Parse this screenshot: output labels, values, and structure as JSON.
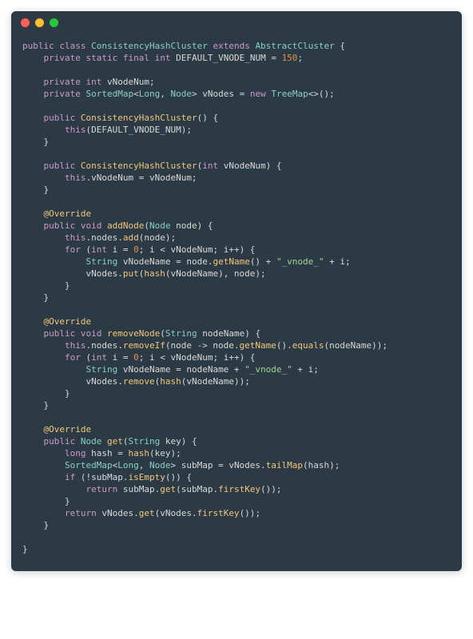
{
  "window": {
    "traffic_lights": [
      "close",
      "minimize",
      "zoom"
    ]
  },
  "code": {
    "tokens": [
      [
        [
          "kw",
          "public"
        ],
        [
          "punc",
          " "
        ],
        [
          "kw",
          "class"
        ],
        [
          "punc",
          " "
        ],
        [
          "type",
          "ConsistencyHashCluster"
        ],
        [
          "punc",
          " "
        ],
        [
          "kw",
          "extends"
        ],
        [
          "punc",
          " "
        ],
        [
          "type",
          "AbstractCluster"
        ],
        [
          "punc",
          " {"
        ]
      ],
      [
        [
          "punc",
          "    "
        ],
        [
          "kw",
          "private"
        ],
        [
          "punc",
          " "
        ],
        [
          "kw",
          "static"
        ],
        [
          "punc",
          " "
        ],
        [
          "kw",
          "final"
        ],
        [
          "punc",
          " "
        ],
        [
          "kw",
          "int"
        ],
        [
          "punc",
          " DEFAULT_VNODE_NUM = "
        ],
        [
          "num",
          "150"
        ],
        [
          "punc",
          ";"
        ]
      ],
      [
        [
          "punc",
          ""
        ]
      ],
      [
        [
          "punc",
          "    "
        ],
        [
          "kw",
          "private"
        ],
        [
          "punc",
          " "
        ],
        [
          "kw",
          "int"
        ],
        [
          "punc",
          " vNodeNum;"
        ]
      ],
      [
        [
          "punc",
          "    "
        ],
        [
          "kw",
          "private"
        ],
        [
          "punc",
          " "
        ],
        [
          "type",
          "SortedMap"
        ],
        [
          "punc",
          "<"
        ],
        [
          "type",
          "Long"
        ],
        [
          "punc",
          ", "
        ],
        [
          "type",
          "Node"
        ],
        [
          "punc",
          "> vNodes = "
        ],
        [
          "kw",
          "new"
        ],
        [
          "punc",
          " "
        ],
        [
          "type",
          "TreeMap"
        ],
        [
          "punc",
          "<>();"
        ]
      ],
      [
        [
          "punc",
          ""
        ]
      ],
      [
        [
          "punc",
          "    "
        ],
        [
          "kw",
          "public"
        ],
        [
          "punc",
          " "
        ],
        [
          "fn",
          "ConsistencyHashCluster"
        ],
        [
          "punc",
          "() {"
        ]
      ],
      [
        [
          "punc",
          "        "
        ],
        [
          "kw",
          "this"
        ],
        [
          "punc",
          "(DEFAULT_VNODE_NUM);"
        ]
      ],
      [
        [
          "punc",
          "    }"
        ]
      ],
      [
        [
          "punc",
          ""
        ]
      ],
      [
        [
          "punc",
          "    "
        ],
        [
          "kw",
          "public"
        ],
        [
          "punc",
          " "
        ],
        [
          "fn",
          "ConsistencyHashCluster"
        ],
        [
          "punc",
          "("
        ],
        [
          "kw",
          "int"
        ],
        [
          "punc",
          " vNodeNum) {"
        ]
      ],
      [
        [
          "punc",
          "        "
        ],
        [
          "kw",
          "this"
        ],
        [
          "punc",
          ".vNodeNum = vNodeNum;"
        ]
      ],
      [
        [
          "punc",
          "    }"
        ]
      ],
      [
        [
          "punc",
          ""
        ]
      ],
      [
        [
          "punc",
          "    "
        ],
        [
          "fn",
          "@Override"
        ]
      ],
      [
        [
          "punc",
          "    "
        ],
        [
          "kw",
          "public"
        ],
        [
          "punc",
          " "
        ],
        [
          "kw",
          "void"
        ],
        [
          "punc",
          " "
        ],
        [
          "fn",
          "addNode"
        ],
        [
          "punc",
          "("
        ],
        [
          "type",
          "Node"
        ],
        [
          "punc",
          " node) {"
        ]
      ],
      [
        [
          "punc",
          "        "
        ],
        [
          "kw",
          "this"
        ],
        [
          "punc",
          ".nodes."
        ],
        [
          "fn",
          "add"
        ],
        [
          "punc",
          "(node);"
        ]
      ],
      [
        [
          "punc",
          "        "
        ],
        [
          "kw",
          "for"
        ],
        [
          "punc",
          " ("
        ],
        [
          "kw",
          "int"
        ],
        [
          "punc",
          " i = "
        ],
        [
          "num",
          "0"
        ],
        [
          "punc",
          "; i < vNodeNum; i++) {"
        ]
      ],
      [
        [
          "punc",
          "            "
        ],
        [
          "type",
          "String"
        ],
        [
          "punc",
          " vNodeName = node."
        ],
        [
          "fn",
          "getName"
        ],
        [
          "punc",
          "() + "
        ],
        [
          "str",
          "\"_vnode_\""
        ],
        [
          "punc",
          " + i;"
        ]
      ],
      [
        [
          "punc",
          "            vNodes."
        ],
        [
          "fn",
          "put"
        ],
        [
          "punc",
          "("
        ],
        [
          "fn",
          "hash"
        ],
        [
          "punc",
          "(vNodeName), node);"
        ]
      ],
      [
        [
          "punc",
          "        }"
        ]
      ],
      [
        [
          "punc",
          "    }"
        ]
      ],
      [
        [
          "punc",
          ""
        ]
      ],
      [
        [
          "punc",
          "    "
        ],
        [
          "fn",
          "@Override"
        ]
      ],
      [
        [
          "punc",
          "    "
        ],
        [
          "kw",
          "public"
        ],
        [
          "punc",
          " "
        ],
        [
          "kw",
          "void"
        ],
        [
          "punc",
          " "
        ],
        [
          "fn",
          "removeNode"
        ],
        [
          "punc",
          "("
        ],
        [
          "type",
          "String"
        ],
        [
          "punc",
          " nodeName) {"
        ]
      ],
      [
        [
          "punc",
          "        "
        ],
        [
          "kw",
          "this"
        ],
        [
          "punc",
          ".nodes."
        ],
        [
          "fn",
          "removeIf"
        ],
        [
          "punc",
          "(node -> node."
        ],
        [
          "fn",
          "getName"
        ],
        [
          "punc",
          "()."
        ],
        [
          "fn",
          "equals"
        ],
        [
          "punc",
          "(nodeName));"
        ]
      ],
      [
        [
          "punc",
          "        "
        ],
        [
          "kw",
          "for"
        ],
        [
          "punc",
          " ("
        ],
        [
          "kw",
          "int"
        ],
        [
          "punc",
          " i = "
        ],
        [
          "num",
          "0"
        ],
        [
          "punc",
          "; i < vNodeNum; i++) {"
        ]
      ],
      [
        [
          "punc",
          "            "
        ],
        [
          "type",
          "String"
        ],
        [
          "punc",
          " vNodeName = nodeName + "
        ],
        [
          "str",
          "\"_vnode_\""
        ],
        [
          "punc",
          " + i;"
        ]
      ],
      [
        [
          "punc",
          "            vNodes."
        ],
        [
          "fn",
          "remove"
        ],
        [
          "punc",
          "("
        ],
        [
          "fn",
          "hash"
        ],
        [
          "punc",
          "(vNodeName));"
        ]
      ],
      [
        [
          "punc",
          "        }"
        ]
      ],
      [
        [
          "punc",
          "    }"
        ]
      ],
      [
        [
          "punc",
          ""
        ]
      ],
      [
        [
          "punc",
          "    "
        ],
        [
          "fn",
          "@Override"
        ]
      ],
      [
        [
          "punc",
          "    "
        ],
        [
          "kw",
          "public"
        ],
        [
          "punc",
          " "
        ],
        [
          "type",
          "Node"
        ],
        [
          "punc",
          " "
        ],
        [
          "fn",
          "get"
        ],
        [
          "punc",
          "("
        ],
        [
          "type",
          "String"
        ],
        [
          "punc",
          " key) {"
        ]
      ],
      [
        [
          "punc",
          "        "
        ],
        [
          "kw",
          "long"
        ],
        [
          "punc",
          " hash = "
        ],
        [
          "fn",
          "hash"
        ],
        [
          "punc",
          "(key);"
        ]
      ],
      [
        [
          "punc",
          "        "
        ],
        [
          "type",
          "SortedMap"
        ],
        [
          "punc",
          "<"
        ],
        [
          "type",
          "Long"
        ],
        [
          "punc",
          ", "
        ],
        [
          "type",
          "Node"
        ],
        [
          "punc",
          "> subMap = vNodes."
        ],
        [
          "fn",
          "tailMap"
        ],
        [
          "punc",
          "(hash);"
        ]
      ],
      [
        [
          "punc",
          "        "
        ],
        [
          "kw",
          "if"
        ],
        [
          "punc",
          " (!subMap."
        ],
        [
          "fn",
          "isEmpty"
        ],
        [
          "punc",
          "()) {"
        ]
      ],
      [
        [
          "punc",
          "            "
        ],
        [
          "kw",
          "return"
        ],
        [
          "punc",
          " subMap."
        ],
        [
          "fn",
          "get"
        ],
        [
          "punc",
          "(subMap."
        ],
        [
          "fn",
          "firstKey"
        ],
        [
          "punc",
          "());"
        ]
      ],
      [
        [
          "punc",
          "        }"
        ]
      ],
      [
        [
          "punc",
          "        "
        ],
        [
          "kw",
          "return"
        ],
        [
          "punc",
          " vNodes."
        ],
        [
          "fn",
          "get"
        ],
        [
          "punc",
          "(vNodes."
        ],
        [
          "fn",
          "firstKey"
        ],
        [
          "punc",
          "());"
        ]
      ],
      [
        [
          "punc",
          "    }"
        ]
      ],
      [
        [
          "punc",
          ""
        ]
      ],
      [
        [
          "punc",
          "}"
        ]
      ]
    ]
  }
}
